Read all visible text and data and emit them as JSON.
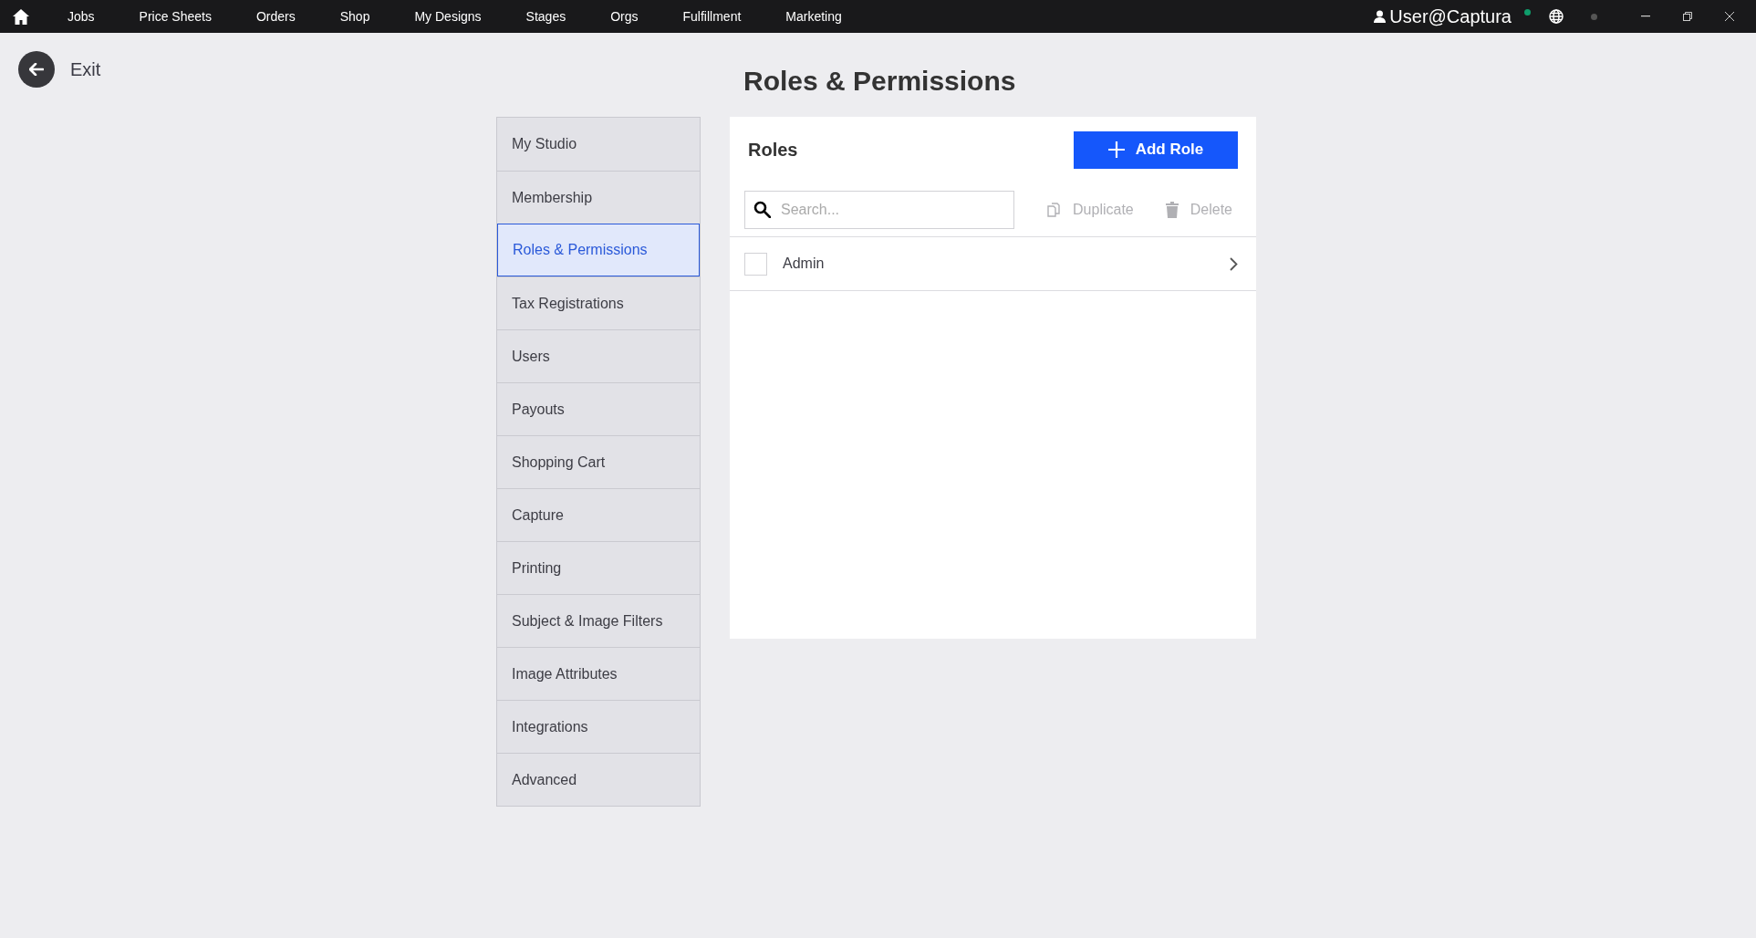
{
  "top_nav": {
    "items": [
      {
        "label": "Jobs"
      },
      {
        "label": "Price Sheets"
      },
      {
        "label": "Orders"
      },
      {
        "label": "Shop"
      },
      {
        "label": "My Designs"
      },
      {
        "label": "Stages"
      },
      {
        "label": "Orgs"
      },
      {
        "label": "Fulfillment"
      },
      {
        "label": "Marketing"
      }
    ],
    "user": "User@Captura"
  },
  "exit": {
    "label": "Exit"
  },
  "page_title": "Roles & Permissions",
  "sidebar": {
    "items": [
      {
        "label": "My Studio",
        "selected": false
      },
      {
        "label": "Membership",
        "selected": false
      },
      {
        "label": "Roles & Permissions",
        "selected": true
      },
      {
        "label": "Tax Registrations",
        "selected": false
      },
      {
        "label": "Users",
        "selected": false
      },
      {
        "label": "Payouts",
        "selected": false
      },
      {
        "label": "Shopping Cart",
        "selected": false
      },
      {
        "label": "Capture",
        "selected": false
      },
      {
        "label": "Printing",
        "selected": false
      },
      {
        "label": "Subject & Image Filters",
        "selected": false
      },
      {
        "label": "Image Attributes",
        "selected": false
      },
      {
        "label": "Integrations",
        "selected": false
      },
      {
        "label": "Advanced",
        "selected": false
      }
    ]
  },
  "roles_panel": {
    "title": "Roles",
    "add_button": "Add Role",
    "search": {
      "placeholder": "Search..."
    },
    "actions": [
      {
        "kind": "duplicate",
        "label": "Duplicate",
        "disabled": true
      },
      {
        "kind": "delete",
        "label": "Delete",
        "disabled": true
      }
    ],
    "rows": [
      {
        "name": "Admin",
        "checked": false
      }
    ]
  }
}
